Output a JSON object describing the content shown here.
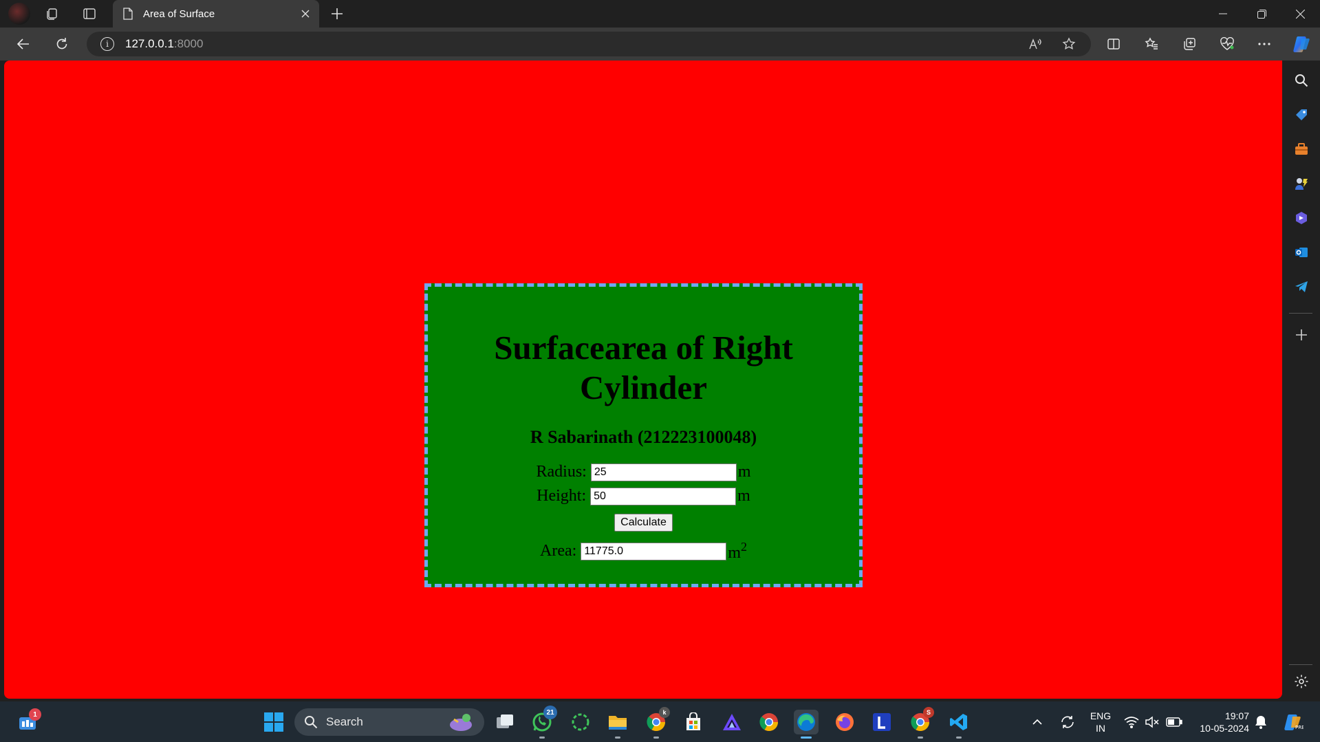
{
  "browser": {
    "tab_title": "Area of Surface",
    "url_host": "127.0.0.1",
    "url_port": ":8000"
  },
  "page": {
    "title": "Surfacearea of Right Cylinder",
    "author": "R Sabarinath (212223100048)",
    "radius_label": "Radius:",
    "radius_value": "25",
    "radius_unit": "m",
    "height_label": "Height:",
    "height_value": "50",
    "height_unit": "m",
    "calculate_label": "Calculate",
    "area_label": "Area:",
    "area_value": "11775.0",
    "area_unit": "m",
    "area_unit_exp": "2",
    "colors": {
      "background": "#ff0000",
      "card": "#008000",
      "card_border": "#6fa8f0"
    }
  },
  "taskbar": {
    "search_label": "Search",
    "notification_count": "1",
    "whatsapp_badge": "21",
    "language_line1": "ENG",
    "language_line2": "IN",
    "time": "19:07",
    "date": "10-05-2024"
  }
}
